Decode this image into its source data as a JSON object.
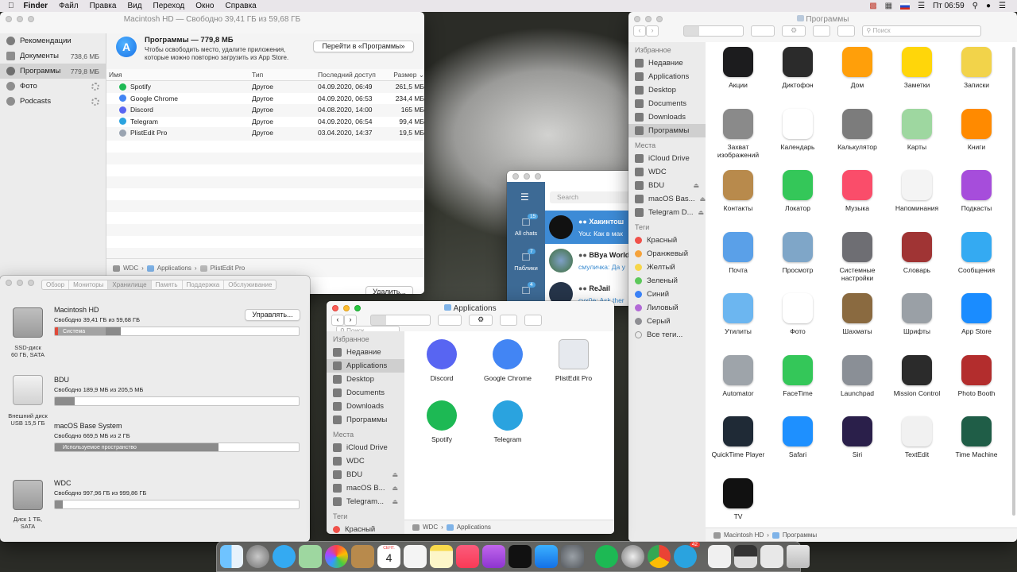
{
  "menubar": {
    "app": "Finder",
    "items": [
      "Файл",
      "Правка",
      "Вид",
      "Переход",
      "Окно",
      "Справка"
    ],
    "clock": "Пт 06:59"
  },
  "storage": {
    "title": "Macintosh HD — Свободно 39,41 ГБ из 59,68 ГБ",
    "sidebar": [
      {
        "label": "Рекомендации",
        "size": ""
      },
      {
        "label": "Документы",
        "size": "738,6 МБ"
      },
      {
        "label": "Программы",
        "size": "779,8 МБ"
      },
      {
        "label": "Фото",
        "size": ""
      },
      {
        "label": "Podcasts",
        "size": ""
      }
    ],
    "header_title": "Программы — 779,8 МБ",
    "header_desc": "Чтобы освободить место, удалите приложения, которые можно повторно загрузить из App Store.",
    "goto_button": "Перейти в «Программы»",
    "columns": [
      "Имя",
      "Тип",
      "Последний доступ",
      "Размер"
    ],
    "rows": [
      {
        "name": "Spotify",
        "type": "Другое",
        "date": "04.09.2020, 06:49",
        "size": "261,5 МБ",
        "color": "#1db954"
      },
      {
        "name": "Google Chrome",
        "type": "Другое",
        "date": "04.09.2020, 06:53",
        "size": "234,4 МБ",
        "color": "#4285f4"
      },
      {
        "name": "Discord",
        "type": "Другое",
        "date": "04.08.2020, 14:00",
        "size": "165 МБ",
        "color": "#5865f2"
      },
      {
        "name": "Telegram",
        "type": "Другое",
        "date": "04.09.2020, 06:54",
        "size": "99,4 МБ",
        "color": "#2aa3df"
      },
      {
        "name": "PlistEdit Pro",
        "type": "Другое",
        "date": "03.04.2020, 14:37",
        "size": "19,5 МБ",
        "color": "#9aa4b1"
      }
    ],
    "path": [
      "WDC",
      "Applications",
      "PlistEdit Pro"
    ],
    "delete_button": "Удалить..."
  },
  "disk": {
    "tabs": [
      "Обзор",
      "Мониторы",
      "Хранилище",
      "Память",
      "Поддержка",
      "Обслуживание"
    ],
    "active_tab": "Хранилище",
    "volumes": [
      {
        "name": "Macintosh HD",
        "free": "Свободно 39,41 ГБ из 59,68 ГБ",
        "bar_label": "Система",
        "used_fraction": 0.27,
        "icon_label": "SSD-диск\n60 ГБ, SATA"
      },
      {
        "name": "BDU",
        "free": "Свободно 189,9 МБ из 205,5 МБ",
        "bar_label": "",
        "used_fraction": 0.08,
        "icon_label": "Внешний диск\nUSB 15,5 ГБ"
      },
      {
        "name": "macOS Base System",
        "free": "Свободно 669,5 МБ из 2 ГБ",
        "bar_label": "Используемое пространство",
        "used_fraction": 0.67,
        "icon_label": ""
      },
      {
        "name": "WDC",
        "free": "Свободно 997,96 ГБ из 999,86 ГБ",
        "bar_label": "",
        "used_fraction": 0.0,
        "icon_label": "Диск 1 ТБ,\nSATA"
      }
    ],
    "manage_button": "Управлять..."
  },
  "telegram": {
    "search": "Search",
    "nav": [
      {
        "label": "All chats",
        "badge": "15"
      },
      {
        "label": "Паблики",
        "badge": "7"
      },
      {
        "label": "",
        "badge": "4"
      }
    ],
    "chats": [
      {
        "name": "Хакинтош",
        "msg": "You: Как в мак"
      },
      {
        "name": "BBya World",
        "msg": "смуличка: Да у"
      },
      {
        "name": "ReJail",
        "msg": "cyx0e: Ask ther"
      }
    ]
  },
  "apps_window": {
    "title": "Applications",
    "search_placeholder": "Поиск",
    "favorites_header": "Избранное",
    "favorites": [
      "Недавние",
      "Applications",
      "Desktop",
      "Documents",
      "Downloads",
      "Программы"
    ],
    "locations_header": "Места",
    "locations": [
      "iCloud Drive",
      "WDC",
      "BDU",
      "macOS B...",
      "Telegram..."
    ],
    "tags_header": "Теги",
    "tags": [
      "Красный"
    ],
    "items": [
      {
        "label": "Discord",
        "color": "#5865f2"
      },
      {
        "label": "Google Chrome",
        "color": "#4285f4"
      },
      {
        "label": "PlistEdit Pro",
        "color": "#e6e9ee"
      },
      {
        "label": "Spotify",
        "color": "#1db954"
      },
      {
        "label": "Telegram",
        "color": "#2aa3df"
      }
    ],
    "path": [
      "WDC",
      "Applications"
    ]
  },
  "prog_window": {
    "title": "Программы",
    "search_placeholder": "Поиск",
    "favorites_header": "Избранное",
    "favorites": [
      "Недавние",
      "Applications",
      "Desktop",
      "Documents",
      "Downloads",
      "Программы"
    ],
    "locations_header": "Места",
    "locations": [
      "iCloud Drive",
      "WDC",
      "BDU",
      "macOS Bas...",
      "Telegram D..."
    ],
    "tags_header": "Теги",
    "tags": [
      {
        "label": "Красный",
        "color": "#f0514a"
      },
      {
        "label": "Оранжевый",
        "color": "#f5a23a"
      },
      {
        "label": "Желтый",
        "color": "#f6d64a"
      },
      {
        "label": "Зеленый",
        "color": "#5cc85a"
      },
      {
        "label": "Синий",
        "color": "#3b82f6"
      },
      {
        "label": "Лиловый",
        "color": "#b26ad6"
      },
      {
        "label": "Серый",
        "color": "#8e8e93"
      },
      {
        "label": "Все теги...",
        "color": ""
      }
    ],
    "apps": [
      {
        "label": "Акции",
        "color": "#1c1c1e"
      },
      {
        "label": "Диктофон",
        "color": "#2b2b2b"
      },
      {
        "label": "Дом",
        "color": "#ff9f0a"
      },
      {
        "label": "Заметки",
        "color": "#ffd60a"
      },
      {
        "label": "Записки",
        "color": "#f2d34a"
      },
      {
        "label": "Захват изображений",
        "color": "#8a8a8a"
      },
      {
        "label": "Календарь",
        "color": "#ffffff"
      },
      {
        "label": "Калькулятор",
        "color": "#7c7c7c"
      },
      {
        "label": "Карты",
        "color": "#9ed7a0"
      },
      {
        "label": "Книги",
        "color": "#ff8a00"
      },
      {
        "label": "Контакты",
        "color": "#b88a4c"
      },
      {
        "label": "Локатор",
        "color": "#34c759"
      },
      {
        "label": "Музыка",
        "color": "#fa4d6a"
      },
      {
        "label": "Напоминания",
        "color": "#f4f4f4"
      },
      {
        "label": "Подкасты",
        "color": "#a64ddb"
      },
      {
        "label": "Почта",
        "color": "#5aa0e8"
      },
      {
        "label": "Просмотр",
        "color": "#7fa6c8"
      },
      {
        "label": "Системные настройки",
        "color": "#6e6e73"
      },
      {
        "label": "Словарь",
        "color": "#a03434"
      },
      {
        "label": "Сообщения",
        "color": "#34aaf2"
      },
      {
        "label": "Утилиты",
        "color": "#6cb6f0"
      },
      {
        "label": "Фото",
        "color": "#ffffff"
      },
      {
        "label": "Шахматы",
        "color": "#8a6a40"
      },
      {
        "label": "Шрифты",
        "color": "#9aa0a6"
      },
      {
        "label": "App Store",
        "color": "#1a8cff"
      },
      {
        "label": "Automator",
        "color": "#9ea4aa"
      },
      {
        "label": "FaceTime",
        "color": "#34c759"
      },
      {
        "label": "Launchpad",
        "color": "#8a8f96"
      },
      {
        "label": "Mission Control",
        "color": "#2b2b2b"
      },
      {
        "label": "Photo Booth",
        "color": "#b32d2d"
      },
      {
        "label": "QuickTime Player",
        "color": "#1f2a36"
      },
      {
        "label": "Safari",
        "color": "#1e90ff"
      },
      {
        "label": "Siri",
        "color": "#2a1f4a"
      },
      {
        "label": "TextEdit",
        "color": "#f1f1f1"
      },
      {
        "label": "Time Machine",
        "color": "#1f5d47"
      },
      {
        "label": "TV",
        "color": "#111111"
      }
    ],
    "path": [
      "Macintosh HD",
      "Программы"
    ]
  },
  "dock": {
    "badge": "42",
    "calendar_month": "СЕНТ.",
    "calendar_day": "4"
  }
}
